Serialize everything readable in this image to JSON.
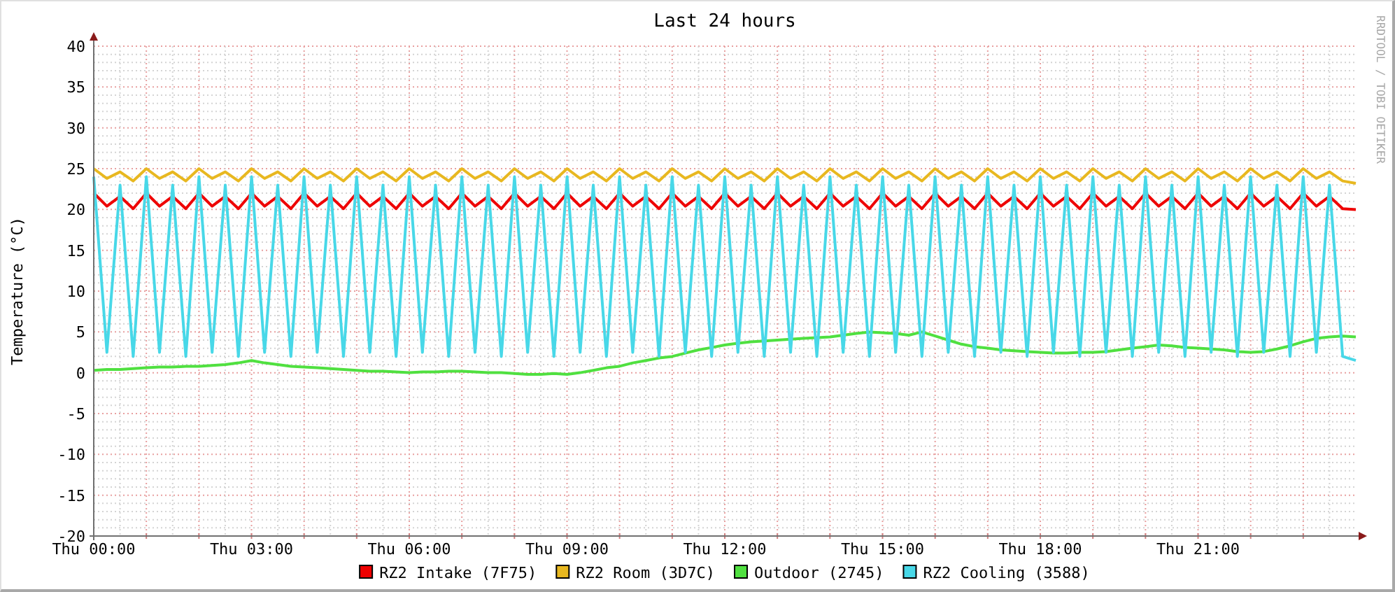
{
  "chart": {
    "chart_data": {
      "type": "line",
      "title": "Last 24 hours",
      "ylabel": "Temperature (°C)",
      "ylim": [
        -20,
        40
      ],
      "grid": true,
      "legend": true,
      "yticks": [
        -20,
        -15,
        -10,
        -5,
        0,
        5,
        10,
        15,
        20,
        25,
        30,
        35,
        40
      ],
      "categories": [
        "Thu 00:00",
        null,
        null,
        null,
        null,
        null,
        null,
        null,
        null,
        null,
        null,
        null,
        "Thu 03:00",
        null,
        null,
        null,
        null,
        null,
        null,
        null,
        null,
        null,
        null,
        null,
        "Thu 06:00",
        null,
        null,
        null,
        null,
        null,
        null,
        null,
        null,
        null,
        null,
        null,
        "Thu 09:00",
        null,
        null,
        null,
        null,
        null,
        null,
        null,
        null,
        null,
        null,
        null,
        "Thu 12:00",
        null,
        null,
        null,
        null,
        null,
        null,
        null,
        null,
        null,
        null,
        null,
        "Thu 15:00",
        null,
        null,
        null,
        null,
        null,
        null,
        null,
        null,
        null,
        null,
        null,
        "Thu 18:00",
        null,
        null,
        null,
        null,
        null,
        null,
        null,
        null,
        null,
        null,
        null,
        "Thu 21:00",
        null,
        null,
        null,
        null,
        null,
        null,
        null,
        null,
        null,
        null,
        null,
        null
      ],
      "series": [
        {
          "name": "RZ2 Intake (7F75)",
          "color": "#ee0000",
          "values": [
            22,
            20.4,
            21.6,
            20.1,
            22,
            20.4,
            21.6,
            20.1,
            22,
            20.4,
            21.6,
            20.1,
            22,
            20.4,
            21.6,
            20.1,
            22,
            20.4,
            21.6,
            20.1,
            22,
            20.4,
            21.6,
            20.1,
            22,
            20.4,
            21.6,
            20.1,
            22,
            20.4,
            21.6,
            20.1,
            22,
            20.4,
            21.6,
            20.1,
            22,
            20.4,
            21.6,
            20.1,
            22,
            20.4,
            21.6,
            20.1,
            22,
            20.4,
            21.6,
            20.1,
            22,
            20.4,
            21.6,
            20.1,
            22,
            20.4,
            21.6,
            20.1,
            22,
            20.4,
            21.6,
            20.1,
            22,
            20.4,
            21.6,
            20.1,
            22,
            20.4,
            21.6,
            20.1,
            22,
            20.4,
            21.6,
            20.1,
            22,
            20.4,
            21.6,
            20.1,
            22,
            20.4,
            21.6,
            20.1,
            22,
            20.4,
            21.6,
            20.1,
            22,
            20.4,
            21.6,
            20.1,
            22,
            20.4,
            21.6,
            20.1,
            22,
            20.4,
            21.6,
            20.1,
            20
          ]
        },
        {
          "name": "RZ2 Room (3D7C)",
          "color": "#e8b820",
          "values": [
            25,
            23.8,
            24.6,
            23.5,
            25,
            23.8,
            24.6,
            23.5,
            25,
            23.8,
            24.6,
            23.5,
            25,
            23.8,
            24.6,
            23.5,
            25,
            23.8,
            24.6,
            23.5,
            25,
            23.8,
            24.6,
            23.5,
            25,
            23.8,
            24.6,
            23.5,
            25,
            23.8,
            24.6,
            23.5,
            25,
            23.8,
            24.6,
            23.5,
            25,
            23.8,
            24.6,
            23.5,
            25,
            23.8,
            24.6,
            23.5,
            25,
            23.8,
            24.6,
            23.5,
            25,
            23.8,
            24.6,
            23.5,
            25,
            23.8,
            24.6,
            23.5,
            25,
            23.8,
            24.6,
            23.5,
            25,
            23.8,
            24.6,
            23.5,
            25,
            23.8,
            24.6,
            23.5,
            25,
            23.8,
            24.6,
            23.5,
            25,
            23.8,
            24.6,
            23.5,
            25,
            23.8,
            24.6,
            23.5,
            25,
            23.8,
            24.6,
            23.5,
            25,
            23.8,
            24.6,
            23.5,
            25,
            23.8,
            24.6,
            23.5,
            25,
            23.8,
            24.6,
            23.5,
            23.2
          ]
        },
        {
          "name": "Outdoor (2745)",
          "color": "#50e040",
          "values": [
            0.3,
            0.4,
            0.4,
            0.5,
            0.6,
            0.7,
            0.7,
            0.8,
            0.8,
            0.9,
            1.0,
            1.2,
            1.5,
            1.2,
            1.0,
            0.8,
            0.7,
            0.6,
            0.5,
            0.4,
            0.3,
            0.2,
            0.2,
            0.1,
            0.0,
            0.1,
            0.1,
            0.2,
            0.2,
            0.1,
            0.0,
            0.0,
            -0.1,
            -0.2,
            -0.2,
            -0.1,
            -0.2,
            0.0,
            0.3,
            0.6,
            0.8,
            1.2,
            1.5,
            1.8,
            2.0,
            2.4,
            2.8,
            3.1,
            3.4,
            3.6,
            3.8,
            3.9,
            4.0,
            4.1,
            4.2,
            4.3,
            4.4,
            4.6,
            4.8,
            5.0,
            4.9,
            4.8,
            4.6,
            5.0,
            4.5,
            4.0,
            3.5,
            3.2,
            3.0,
            2.8,
            2.7,
            2.6,
            2.5,
            2.4,
            2.4,
            2.5,
            2.5,
            2.6,
            2.8,
            3.0,
            3.2,
            3.4,
            3.3,
            3.1,
            3.0,
            2.9,
            2.8,
            2.6,
            2.5,
            2.6,
            2.9,
            3.3,
            3.8,
            4.2,
            4.4,
            4.5,
            4.4
          ]
        },
        {
          "name": "RZ2 Cooling (3588)",
          "color": "#48d8e8",
          "values": [
            24,
            2.5,
            23,
            2,
            24,
            2.5,
            23,
            2,
            24,
            2.5,
            23,
            2,
            24,
            2.5,
            23,
            2,
            24,
            2.5,
            23,
            2,
            24,
            2.5,
            23,
            2,
            24,
            2.5,
            23,
            2,
            24,
            2.5,
            23,
            2,
            24,
            2.5,
            23,
            2,
            24,
            2.5,
            23,
            2,
            24,
            2.5,
            23,
            2,
            24,
            2.5,
            23,
            2,
            24,
            2.5,
            23,
            2,
            24,
            2.5,
            23,
            2,
            24,
            2.5,
            23,
            2,
            24,
            2.5,
            23,
            2,
            24,
            2.5,
            23,
            2,
            24,
            2.5,
            23,
            2,
            24,
            2.5,
            23,
            2,
            24,
            2.5,
            23,
            2,
            24,
            2.5,
            23,
            2,
            24,
            2.5,
            23,
            2,
            24,
            2.5,
            23,
            2,
            24,
            2.5,
            23,
            2,
            1.5
          ]
        }
      ]
    }
  },
  "credit": "RRDTOOL / TOBI OETIKER"
}
